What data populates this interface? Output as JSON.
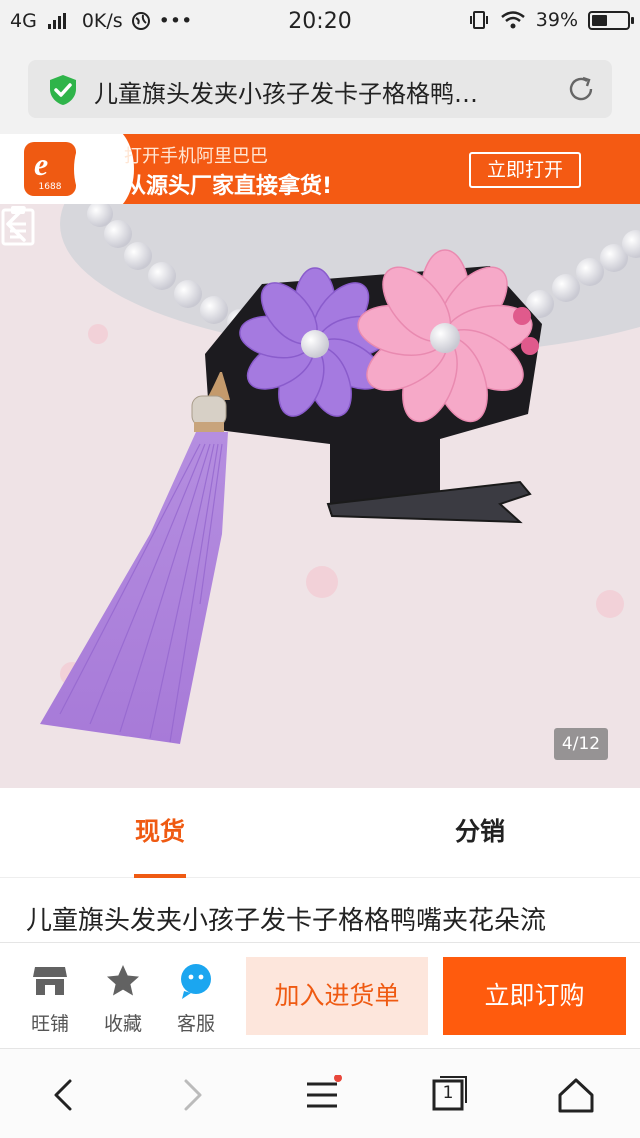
{
  "status_bar": {
    "network": "4G",
    "speed": "0K/s",
    "more": "•••",
    "time": "20:20",
    "battery": "39%",
    "battery_level": 0.39
  },
  "address_bar": {
    "title": "儿童旗头发夹小孩子发卡子格格鸭…",
    "secure_icon": "shield-check-icon",
    "reload_icon": "reload-icon"
  },
  "banner": {
    "logo_letter": "e",
    "logo_number": "1688",
    "line1": "打开手机阿里巴巴",
    "line2": "从源头厂家直接拿货!",
    "open_button": "立即打开"
  },
  "gallery": {
    "counter": "4/12",
    "back_icon": "chevron-left-icon",
    "clipboard_icon": "clipboard-icon"
  },
  "tabs": [
    {
      "label": "现货",
      "active": true
    },
    {
      "label": "分销",
      "active": false
    }
  ],
  "product": {
    "title": "儿童旗头发夹小孩子发卡子格格鸭嘴夹花朵流"
  },
  "action_bar": {
    "shop_label": "旺铺",
    "favorite_label": "收藏",
    "service_label": "客服",
    "cart_button": "加入进货单",
    "buy_button": "立即订购"
  },
  "nav_bar": {
    "tab_count": "1",
    "colors": {
      "accent": "#ff5b0d",
      "banner": "#f45a13",
      "badge": "#e8473b"
    }
  }
}
